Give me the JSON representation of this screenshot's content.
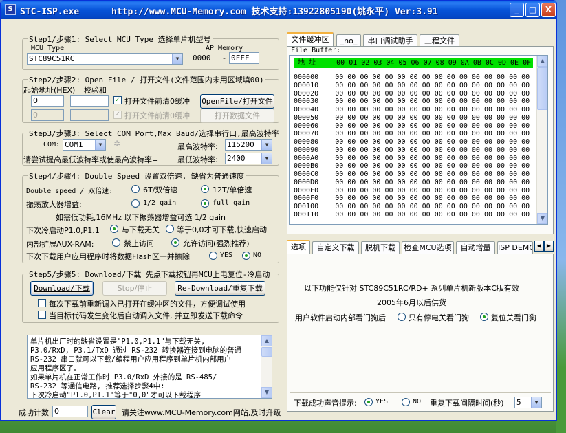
{
  "window": {
    "title": "STC-ISP.exe      http://www.MCU-Memory.com 技术支持:13922805190(姚永平) Ver:3.91",
    "minimize": "_",
    "maximize": "□",
    "close": "X"
  },
  "step1": {
    "title": "Step1/步骤1: Select MCU Type  选择单片机型号",
    "mcu_type_label": "MCU Type",
    "mcu_type_value": "STC89C51RC",
    "ap_memory_label": "AP Memory",
    "ap_start": "0000",
    "ap_sep": "-",
    "ap_end": "0FFF"
  },
  "step2": {
    "title": "Step2/步骤2: Open File / 打开文件(文件范围内未用区域填00)",
    "start_addr_label": "起始地址(HEX)",
    "checksum_label": "校验和",
    "addr1": "0",
    "checksum1": "",
    "clear_buffer1": "打开文件前清0缓冲",
    "open_file_button": "OpenFile/打开文件",
    "addr2": "0",
    "checksum2": "",
    "clear_buffer2": "打开文件前清0缓冲",
    "open_data_button": "打开数据文件"
  },
  "step3": {
    "title": "Step3/步骤3: Select COM Port,Max Baud/选择串行口,最高波特率",
    "com_label": "COM:",
    "com_value": "COM1",
    "max_baud_label": "最高波特率:",
    "max_baud_value": "115200",
    "hint": "请尝试提高最低波特率或使最高波特率=",
    "min_baud_label": "最低波特率:",
    "min_baud_value": "2400"
  },
  "step4": {
    "title": "Step4/步骤4: Double Speed  设置双倍速, 缺省为普通速度",
    "double_speed_label": "Double speed / 双倍速:",
    "opt_6t": "6T/双倍速",
    "opt_12t": "12T/单倍速",
    "osc_label": "振荡放大器增益:",
    "opt_half_gain": "1/2 gain",
    "opt_full_gain": "full gain",
    "osc_hint": "如需低功耗,16MHz 以下振荡器增益可选 1/2 gain",
    "p10_label": "下次冷启动P1.0,P1.1",
    "opt_p10_free": "与下载无关",
    "opt_p10_zero": "等于0,0才可下载,快速启动",
    "aux_ram_label": "内部扩展AUX-RAM:",
    "opt_aux_off": "禁止访问",
    "opt_aux_on": "允许访问(强烈推荐)",
    "erase_label": "下次下载用户应用程序时将数据Flash区一并擦除",
    "opt_yes": "YES",
    "opt_no": "NO"
  },
  "step5": {
    "title": "Step5/步骤5: Download/下载  先点下载按钮再MCU上电复位-冷启动",
    "download_button": "Download/下载",
    "stop_button": "Stop/停止",
    "redownload_button": "Re-Download/重复下载",
    "reload_before": "每次下载前重新调入已打开在缓冲区的文件，方便调试使用",
    "auto_reload": "当目标代码发生变化后自动调入文件, 并立即发送下载命令"
  },
  "memo": {
    "lines": [
      "    单片机出厂时的缺省设置是\"P1.0,P1.1\"与下载无关,",
      "P3.0/RxD, P3.1/TxD 通过 RS-232 转换器连接到电脑的普通",
      "RS-232 串口就可以下载/编程用户应用程序到单片机内部用户",
      "应用程序区了。",
      "    如果单片机在正常工作时 P3.0/RxD 外接的是 RS-485/",
      "RS-232 等通信电路, 推荐选择步骤4中:",
      "    下次冷启动\"P1.0,P1.1\"等于\"0,0\"才可以下载程序"
    ]
  },
  "bottom": {
    "count_label": "成功计数",
    "count_value": "0",
    "clear_button": "Clear",
    "footer": "请关注www.MCU-Memory.com网站,及时升级"
  },
  "right_top": {
    "tabs": [
      "文件缓冲区",
      "_no_",
      "串口调试助手",
      "工程文件"
    ],
    "buffer_label": "File Buffer:",
    "header": " 地 址     00 01 02 03 04 05 06 07 08 09 0A 0B 0C 0D 0E 0F ",
    "addresses": [
      "000000",
      "000010",
      "000020",
      "000030",
      "000040",
      "000050",
      "000060",
      "000070",
      "000080",
      "000090",
      "0000A0",
      "0000B0",
      "0000C0",
      "0000D0",
      "0000E0",
      "0000F0",
      "000100",
      "000110"
    ],
    "row_values": "00 00 00 00 00 00 00 00 00 00 00 00 00 00 00 00"
  },
  "right_bottom": {
    "tabs": [
      "选项",
      "自定义下载",
      "脱机下载",
      "检查MCU选项",
      "自动增量",
      "ISP DEMO"
    ],
    "line1": "以下功能仅针对 STC89C51RC/RD+ 系列单片机新版本C版有效",
    "line2": "2005年6月以后供货",
    "watchdog_label": "用户软件启动内部看门狗后",
    "opt_wd_stop": "只有停电关看门狗",
    "opt_wd_reset": "复位关看门狗",
    "beep_label": "下载成功声音提示:",
    "beep_yes": "YES",
    "beep_no": "NO",
    "interval_label": "重复下载间隔时间(秒)",
    "interval_value": "5"
  },
  "colors": {
    "titlebar": "#0653d8",
    "window_bg": "#ece9d8",
    "hex_header": "#00e000",
    "checkmark": "#21a121"
  }
}
